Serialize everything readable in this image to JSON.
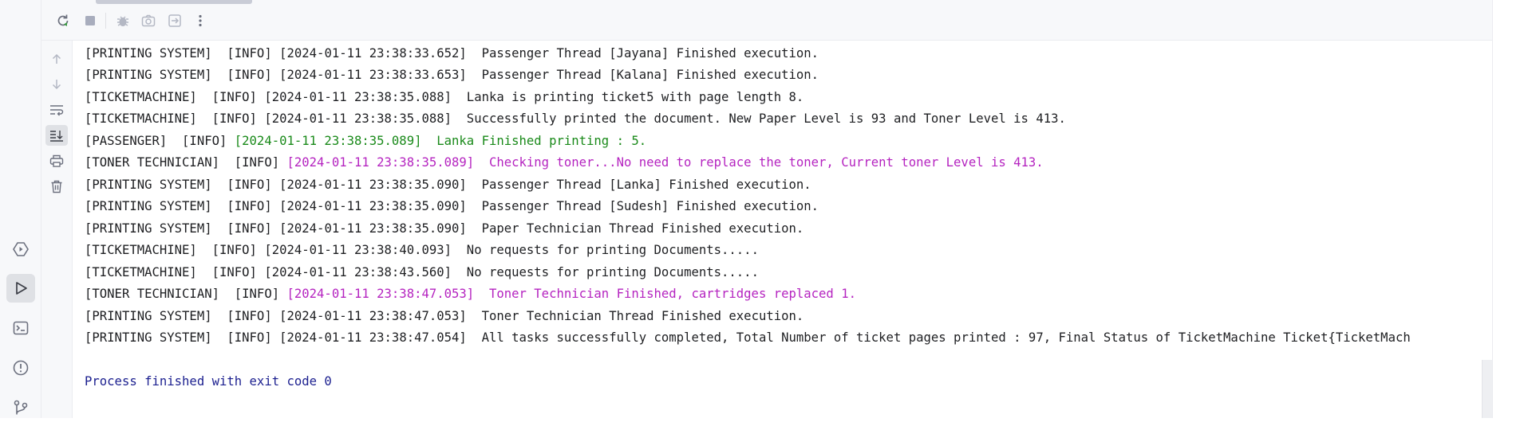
{
  "toolbar": {
    "icons": [
      "rerun-icon",
      "stop-icon",
      "debug-icon",
      "screenshot-icon",
      "exit-icon",
      "more-options-icon"
    ]
  },
  "left_strip": {
    "icons": [
      "services-icon",
      "run-icon",
      "terminal-icon",
      "problems-icon",
      "git-icon"
    ]
  },
  "gutter": {
    "icons": [
      "scroll-up-icon",
      "scroll-down-icon",
      "soft-wrap-icon",
      "scroll-to-end-icon",
      "print-icon",
      "clear-icon"
    ]
  },
  "colors": {
    "default_text": "#1e1f22",
    "green_text": "#1a8a1a",
    "magenta_text": "#b524c0",
    "exit_text": "#1b1f8f"
  },
  "console": {
    "lines": [
      {
        "prefix": "[PRINTING SYSTEM]  [INFO] ",
        "body": "[2024-01-11 23:38:33.652]  Passenger Thread [Jayana] Finished execution.",
        "color": "default"
      },
      {
        "prefix": "[PRINTING SYSTEM]  [INFO] ",
        "body": "[2024-01-11 23:38:33.653]  Passenger Thread [Kalana] Finished execution.",
        "color": "default"
      },
      {
        "prefix": "[TICKETMACHINE]  [INFO] ",
        "body": "[2024-01-11 23:38:35.088]  Lanka is printing ticket5 with page length 8.",
        "color": "default"
      },
      {
        "prefix": "[TICKETMACHINE]  [INFO] ",
        "body": "[2024-01-11 23:38:35.088]  Successfully printed the document. New Paper Level is 93 and Toner Level is 413.",
        "color": "default"
      },
      {
        "prefix": "[PASSENGER]  [INFO] ",
        "body": "[2024-01-11 23:38:35.089]  Lanka Finished printing : 5.",
        "color": "green"
      },
      {
        "prefix": "[TONER TECHNICIAN]  [INFO] ",
        "body": "[2024-01-11 23:38:35.089]  Checking toner...No need to replace the toner, Current toner Level is 413.",
        "color": "magenta"
      },
      {
        "prefix": "[PRINTING SYSTEM]  [INFO] ",
        "body": "[2024-01-11 23:38:35.090]  Passenger Thread [Lanka] Finished execution.",
        "color": "default"
      },
      {
        "prefix": "[PRINTING SYSTEM]  [INFO] ",
        "body": "[2024-01-11 23:38:35.090]  Passenger Thread [Sudesh] Finished execution.",
        "color": "default"
      },
      {
        "prefix": "[PRINTING SYSTEM]  [INFO] ",
        "body": "[2024-01-11 23:38:35.090]  Paper Technician Thread Finished execution.",
        "color": "default"
      },
      {
        "prefix": "[TICKETMACHINE]  [INFO] ",
        "body": "[2024-01-11 23:38:40.093]  No requests for printing Documents.....",
        "color": "default"
      },
      {
        "prefix": "[TICKETMACHINE]  [INFO] ",
        "body": "[2024-01-11 23:38:43.560]  No requests for printing Documents.....",
        "color": "default"
      },
      {
        "prefix": "[TONER TECHNICIAN]  [INFO] ",
        "body": "[2024-01-11 23:38:47.053]  Toner Technician Finished, cartridges replaced 1.",
        "color": "magenta"
      },
      {
        "prefix": "[PRINTING SYSTEM]  [INFO] ",
        "body": "[2024-01-11 23:38:47.053]  Toner Technician Thread Finished execution.",
        "color": "default"
      },
      {
        "prefix": "[PRINTING SYSTEM]  [INFO] ",
        "body": "[2024-01-11 23:38:47.054]  All tasks successfully completed, Total Number of ticket pages printed : 97, Final Status of TicketMachine Ticket{TicketMach",
        "color": "default"
      }
    ],
    "exit_message": "Process finished with exit code 0"
  }
}
